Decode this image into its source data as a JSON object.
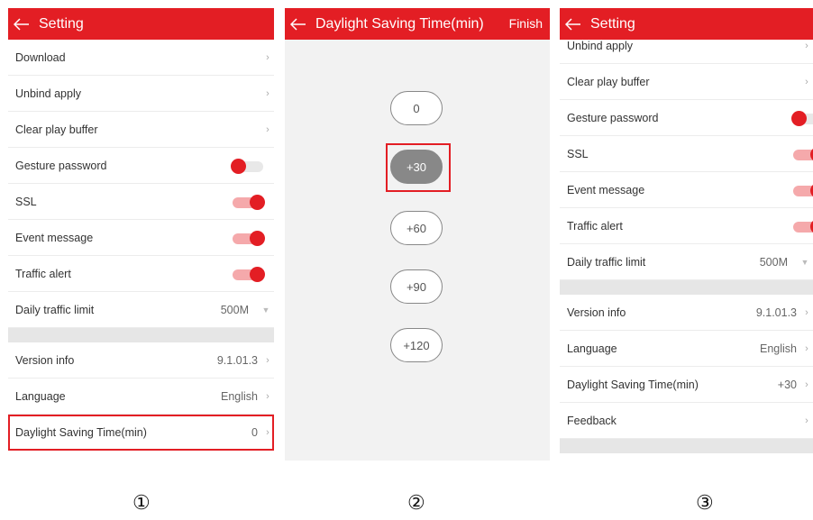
{
  "panel1": {
    "title": "Setting",
    "rows": [
      {
        "label": "Download",
        "type": "chevron"
      },
      {
        "label": "Unbind apply",
        "type": "chevron"
      },
      {
        "label": "Clear play buffer",
        "type": "chevron"
      },
      {
        "label": "Gesture password",
        "type": "toggle",
        "state": "off"
      },
      {
        "label": "SSL",
        "type": "toggle",
        "state": "on"
      },
      {
        "label": "Event message",
        "type": "toggle",
        "state": "on"
      },
      {
        "label": "Traffic alert",
        "type": "toggle",
        "state": "on"
      },
      {
        "label": "Daily traffic limit",
        "type": "dropdown",
        "value": "500M"
      },
      {
        "label": "Version info",
        "type": "chevron",
        "value": "9.1.01.3"
      },
      {
        "label": "Language",
        "type": "chevron",
        "value": "English"
      },
      {
        "label": "Daylight Saving Time(min)",
        "type": "chevron",
        "value": "0"
      }
    ]
  },
  "panel2": {
    "title": "Daylight Saving Time(min)",
    "finish": "Finish",
    "options": [
      "0",
      "+30",
      "+60",
      "+90",
      "+120"
    ],
    "selected": "+30"
  },
  "panel3": {
    "title": "Setting",
    "rows": [
      {
        "label": "Unbind apply",
        "type": "chevron"
      },
      {
        "label": "Clear play buffer",
        "type": "chevron"
      },
      {
        "label": "Gesture password",
        "type": "toggle",
        "state": "off"
      },
      {
        "label": "SSL",
        "type": "toggle",
        "state": "on"
      },
      {
        "label": "Event message",
        "type": "toggle",
        "state": "on"
      },
      {
        "label": "Traffic alert",
        "type": "toggle",
        "state": "on"
      },
      {
        "label": "Daily traffic limit",
        "type": "dropdown",
        "value": "500M"
      },
      {
        "label": "Version info",
        "type": "chevron",
        "value": "9.1.01.3"
      },
      {
        "label": "Language",
        "type": "chevron",
        "value": "English"
      },
      {
        "label": "Daylight Saving Time(min)",
        "type": "chevron",
        "value": "+30"
      },
      {
        "label": "Feedback",
        "type": "chevron"
      }
    ]
  },
  "captions": [
    "①",
    "②",
    "③"
  ],
  "icons": {
    "back": "back-arrow-icon",
    "chevron": "chevron-right-icon",
    "dropdown": "dropdown-arrow-icon"
  },
  "colors": {
    "accent": "#e31e24",
    "toggle_on_track": "#f5a9ab",
    "toggle_off_track": "#e8e8e8",
    "selected_option": "#888888"
  }
}
